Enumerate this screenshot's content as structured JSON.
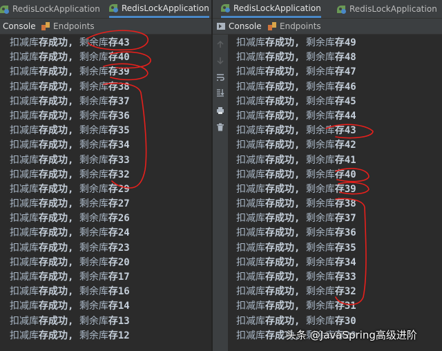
{
  "left_pane": {
    "tabs": [
      {
        "label": "RedisLockApplication",
        "active": false
      },
      {
        "label": "RedisLockApplication",
        "active": true
      }
    ],
    "toolbar": {
      "console_label": "Console",
      "endpoints_label": "Endpoints"
    },
    "lines": [
      {
        "prefix": "扣减库",
        "mid": "存成功,",
        "rest": "剩余库",
        "num": "存43"
      },
      {
        "prefix": "扣减库",
        "mid": "存成功,",
        "rest": "剩余库",
        "num": "存40"
      },
      {
        "prefix": "扣减库",
        "mid": "存成功,",
        "rest": "剩余库",
        "num": "存39"
      },
      {
        "prefix": "扣减库",
        "mid": "存成功,",
        "rest": "剩余库",
        "num": "存38"
      },
      {
        "prefix": "扣减库",
        "mid": "存成功,",
        "rest": "剩余库",
        "num": "存37"
      },
      {
        "prefix": "扣减库",
        "mid": "存成功,",
        "rest": "剩余库",
        "num": "存36"
      },
      {
        "prefix": "扣减库",
        "mid": "存成功,",
        "rest": "剩余库",
        "num": "存35"
      },
      {
        "prefix": "扣减库",
        "mid": "存成功,",
        "rest": "剩余库",
        "num": "存34"
      },
      {
        "prefix": "扣减库",
        "mid": "存成功,",
        "rest": "剩余库",
        "num": "存33"
      },
      {
        "prefix": "扣减库",
        "mid": "存成功,",
        "rest": "剩余库",
        "num": "存32"
      },
      {
        "prefix": "扣减库",
        "mid": "存成功,",
        "rest": "剩余库",
        "num": "存29"
      },
      {
        "prefix": "扣减库",
        "mid": "存成功,",
        "rest": "剩余库",
        "num": "存27"
      },
      {
        "prefix": "扣减库",
        "mid": "存成功,",
        "rest": "剩余库",
        "num": "存26"
      },
      {
        "prefix": "扣减库",
        "mid": "存成功,",
        "rest": "剩余库",
        "num": "存24"
      },
      {
        "prefix": "扣减库",
        "mid": "存成功,",
        "rest": "剩余库",
        "num": "存23"
      },
      {
        "prefix": "扣减库",
        "mid": "存成功,",
        "rest": "剩余库",
        "num": "存20"
      },
      {
        "prefix": "扣减库",
        "mid": "存成功,",
        "rest": "剩余库",
        "num": "存17"
      },
      {
        "prefix": "扣减库",
        "mid": "存成功,",
        "rest": "剩余库",
        "num": "存16"
      },
      {
        "prefix": "扣减库",
        "mid": "存成功,",
        "rest": "剩余库",
        "num": "存14"
      },
      {
        "prefix": "扣减库",
        "mid": "存成功,",
        "rest": "剩余库",
        "num": "存13"
      },
      {
        "prefix": "扣减库",
        "mid": "存成功,",
        "rest": "剩余库",
        "num": "存12"
      }
    ]
  },
  "right_pane": {
    "tabs": [
      {
        "label": "RedisLockApplication",
        "active": true
      },
      {
        "label": "RedisLockApplication",
        "active": false
      }
    ],
    "toolbar": {
      "console_label": "Console",
      "endpoints_label": "Endpoints"
    },
    "lines": [
      {
        "prefix": "扣减库",
        "mid": "存成功,",
        "rest": "剩余库",
        "num": "存49"
      },
      {
        "prefix": "扣减库",
        "mid": "存成功,",
        "rest": "剩余库",
        "num": "存48"
      },
      {
        "prefix": "扣减库",
        "mid": "存成功,",
        "rest": "剩余库",
        "num": "存47"
      },
      {
        "prefix": "扣减库",
        "mid": "存成功,",
        "rest": "剩余库",
        "num": "存46"
      },
      {
        "prefix": "扣减库",
        "mid": "存成功,",
        "rest": "剩余库",
        "num": "存45"
      },
      {
        "prefix": "扣减库",
        "mid": "存成功,",
        "rest": "剩余库",
        "num": "存44"
      },
      {
        "prefix": "扣减库",
        "mid": "存成功,",
        "rest": "剩余库",
        "num": "存43"
      },
      {
        "prefix": "扣减库",
        "mid": "存成功,",
        "rest": "剩余库",
        "num": "存42"
      },
      {
        "prefix": "扣减库",
        "mid": "存成功,",
        "rest": "剩余库",
        "num": "存41"
      },
      {
        "prefix": "扣减库",
        "mid": "存成功,",
        "rest": "剩余库",
        "num": "存40"
      },
      {
        "prefix": "扣减库",
        "mid": "存成功,",
        "rest": "剩余库",
        "num": "存39"
      },
      {
        "prefix": "扣减库",
        "mid": "存成功,",
        "rest": "剩余库",
        "num": "存38"
      },
      {
        "prefix": "扣减库",
        "mid": "存成功,",
        "rest": "剩余库",
        "num": "存37"
      },
      {
        "prefix": "扣减库",
        "mid": "存成功,",
        "rest": "剩余库",
        "num": "存36"
      },
      {
        "prefix": "扣减库",
        "mid": "存成功,",
        "rest": "剩余库",
        "num": "存35"
      },
      {
        "prefix": "扣减库",
        "mid": "存成功,",
        "rest": "剩余库",
        "num": "存34"
      },
      {
        "prefix": "扣减库",
        "mid": "存成功,",
        "rest": "剩余库",
        "num": "存33"
      },
      {
        "prefix": "扣减库",
        "mid": "存成功,",
        "rest": "剩余库",
        "num": "存32"
      },
      {
        "prefix": "扣减库",
        "mid": "存成功,",
        "rest": "剩余库",
        "num": "存31"
      },
      {
        "prefix": "扣减库",
        "mid": "存成功,",
        "rest": "剩余库",
        "num": "存30"
      },
      {
        "prefix": "扣减库",
        "mid": "存成功,",
        "rest": "剩余库",
        "num": "存29"
      }
    ]
  },
  "gutter_icons": [
    "up-arrow-icon",
    "down-arrow-icon",
    "soft-wrap-icon",
    "scroll-to-end-icon",
    "print-icon",
    "trash-icon"
  ],
  "watermark": "头条 @JavaSpring高级进阶",
  "colors": {
    "background": "#2b2b2b",
    "text": "#a9b7c6",
    "annotation": "#e8201c",
    "accent": "#4a88c7"
  }
}
